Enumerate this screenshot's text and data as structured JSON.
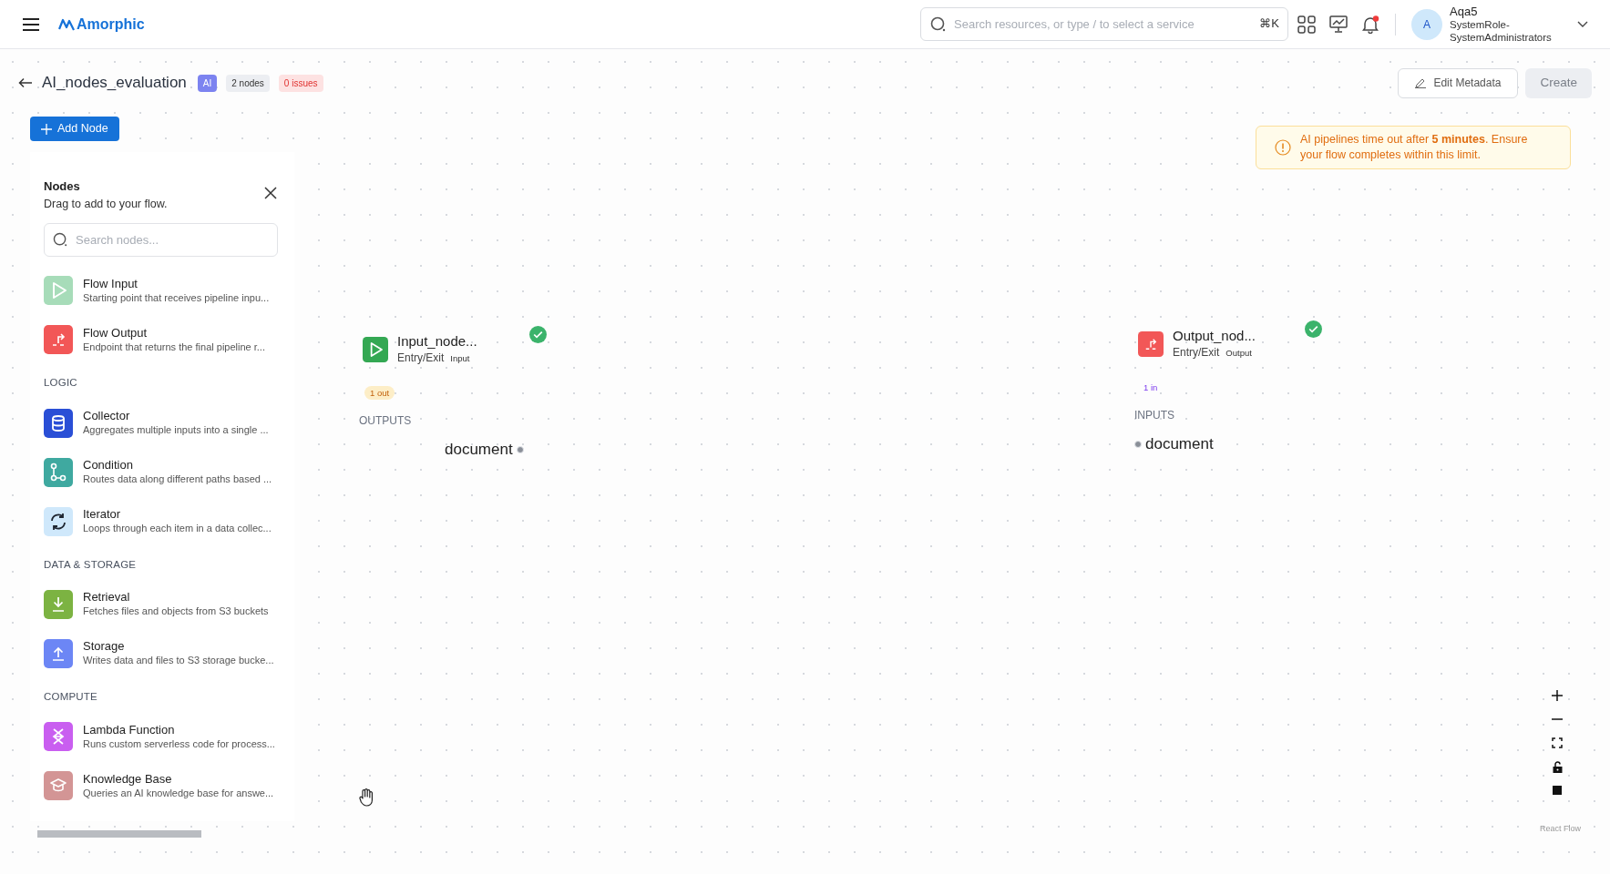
{
  "header": {
    "brand": "Amorphic",
    "search": {
      "placeholder": "Search resources, or type / to select a service",
      "shortcut": "⌘K"
    },
    "notifications_unread": true,
    "user": {
      "avatar": "A",
      "name": "Aqa5",
      "role": "SystemRole-SystemAdministrators"
    }
  },
  "pipeline": {
    "title": "AI_nodes_evaluation",
    "badges": [
      {
        "kind": "ai",
        "text": "AI"
      },
      {
        "kind": "neutral",
        "text": "2 nodes"
      },
      {
        "kind": "danger",
        "text": "0 issues"
      }
    ],
    "buttons": [
      {
        "label": "Edit Metadata",
        "disabled": false
      },
      {
        "label": "Create",
        "disabled": true
      }
    ]
  },
  "add_node_button": "Add Node",
  "nodes_panel": {
    "title": "Nodes",
    "subtitle": "Drag to add to your flow.",
    "search_placeholder": "Search nodes...",
    "sections": [
      {
        "items": [
          {
            "kind": "play",
            "name": "Flow Input",
            "description": "Starting point that receives pipeline inpu...",
            "color": "#a7dcb9"
          },
          {
            "kind": "exit",
            "name": "Flow Output",
            "description": "Endpoint that returns the final pipeline r...",
            "color": "#f25757"
          }
        ]
      },
      {
        "heading": "LOGIC",
        "items": [
          {
            "kind": "database",
            "name": "Collector",
            "description": "Aggregates multiple inputs into a single ...",
            "color": "#2a4fd6"
          },
          {
            "kind": "branch",
            "name": "Condition",
            "description": "Routes data along different paths based ...",
            "color": "#3fa9a0"
          },
          {
            "kind": "loop",
            "name": "Iterator",
            "description": "Loops through each item in a data collec...",
            "color": "#cfe8fb"
          }
        ]
      },
      {
        "heading": "DATA & STORAGE",
        "items": [
          {
            "kind": "download",
            "name": "Retrieval",
            "description": "Fetches files and objects from S3 buckets",
            "color": "#7cb342"
          },
          {
            "kind": "upload",
            "name": "Storage",
            "description": "Writes data and files to S3 storage bucke...",
            "color": "#6c86f5"
          }
        ]
      },
      {
        "heading": "COMPUTE",
        "items": [
          {
            "kind": "lambda",
            "name": "Lambda Function",
            "description": "Runs custom serverless code for process...",
            "color": "#c95ef0"
          },
          {
            "kind": "cap",
            "name": "Knowledge Base",
            "description": "Queries an AI knowledge base for answe...",
            "color": "#d39595"
          }
        ]
      }
    ]
  },
  "warning": "AI pipelines time out after **5 minutes**. Ensure your flow completes within this limit.",
  "canvas_nodes": [
    {
      "kind": "input",
      "title": "Input_node...",
      "category": "Entry/Exit",
      "type": "Input",
      "valid": true,
      "port_count": "1 out",
      "port_section": "OUTPUTS",
      "ports": [
        "document"
      ]
    },
    {
      "kind": "output",
      "title": "Output_nod...",
      "category": "Entry/Exit",
      "type": "Output",
      "valid": true,
      "port_count": "1 in",
      "port_section": "INPUTS",
      "ports": [
        "document"
      ]
    }
  ],
  "attribution": "React Flow"
}
